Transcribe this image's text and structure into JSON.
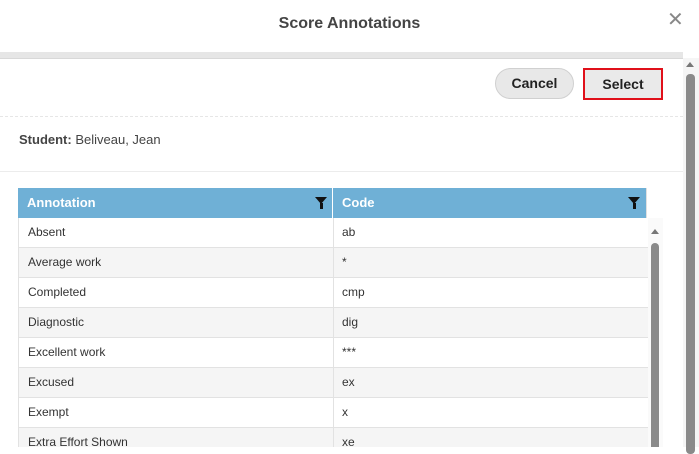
{
  "dialog": {
    "title": "Score Annotations",
    "close_symbol": "✕",
    "cancel_label": "Cancel",
    "select_label": "Select"
  },
  "student": {
    "label": "Student:",
    "name": "Beliveau, Jean"
  },
  "grid": {
    "columns": [
      "Annotation",
      "Code"
    ],
    "rows": [
      {
        "annotation": "Absent",
        "code": "ab"
      },
      {
        "annotation": "Average work",
        "code": "*"
      },
      {
        "annotation": "Completed",
        "code": "cmp"
      },
      {
        "annotation": "Diagnostic",
        "code": "dig"
      },
      {
        "annotation": "Excellent work",
        "code": "***"
      },
      {
        "annotation": "Excused",
        "code": "ex"
      },
      {
        "annotation": "Exempt",
        "code": "x"
      },
      {
        "annotation": "Extra Effort Shown",
        "code": "xe"
      }
    ]
  },
  "icons": {
    "close": "close-icon",
    "filter": "filter-icon",
    "scroll_up": "scroll-up-arrow-icon"
  },
  "colors": {
    "header_bar": "#6fb0d6",
    "select_outline": "#e0101a"
  }
}
